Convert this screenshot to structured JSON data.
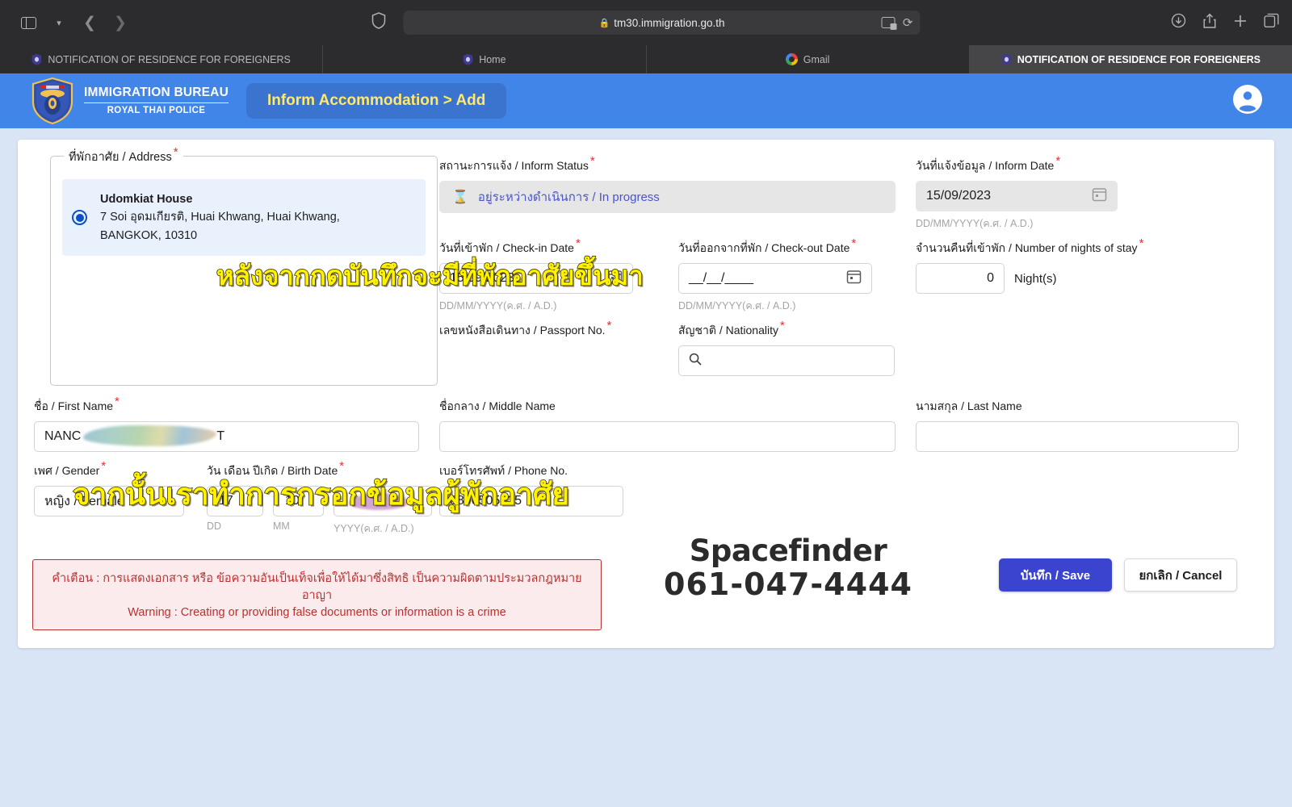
{
  "browser": {
    "url": "tm30.immigration.go.th",
    "lock_icon": "lock-icon",
    "sidebar_icon": "sidebar-toggle-icon",
    "back_icon": "back-chevron-icon",
    "forward_icon": "forward-chevron-icon",
    "shield_icon": "privacy-shield-icon",
    "translate_icon": "translate-icon",
    "reload_icon": "reload-icon",
    "download_icon": "download-icon",
    "share_icon": "share-icon",
    "new_tab_icon": "plus-icon",
    "tab_overview_icon": "tab-overview-icon",
    "tabs": [
      {
        "label": "NOTIFICATION OF RESIDENCE FOR FOREIGNERS",
        "favicon": "immigration-shield-favicon",
        "active": false
      },
      {
        "label": "Home",
        "favicon": "immigration-shield-favicon",
        "active": false
      },
      {
        "label": "Gmail",
        "favicon": "gmail-favicon",
        "active": false
      },
      {
        "label": "NOTIFICATION OF RESIDENCE FOR FOREIGNERS",
        "favicon": "immigration-shield-favicon",
        "active": true
      }
    ]
  },
  "header": {
    "logo_line1": "IMMIGRATION BUREAU",
    "logo_line2": "ROYAL THAI POLICE",
    "page_title": "Inform Accommodation > Add",
    "avatar_icon": "account-circle-icon",
    "bg_color": "#4285e8",
    "pill_color": "#3b74cf",
    "pill_text_color": "#ffe96b"
  },
  "annotations": [
    {
      "text": "หลังจากกดบันทึกจะมีที่พักอาศัยขึ้นมา",
      "color": "#fff200"
    },
    {
      "text": "จากนั้นเราทำการกรอกข้อมูลผู้พักอาศัย",
      "color": "#fff200"
    }
  ],
  "address_section": {
    "legend": "ที่พักอาศัย / Address",
    "required": "*",
    "option": {
      "name": "Udomkiat House",
      "line1": "7 Soi อุดมเกียรติ, Huai Khwang, Huai Khwang,",
      "line2": "BANGKOK, 10310",
      "selected": true,
      "radio_color": "#0b4fc9"
    }
  },
  "form": {
    "inform_status": {
      "label": "สถานะการแจ้ง / Inform Status",
      "value": "อยู่ระหว่างดำเนินการ / In progress",
      "icon": "hourglass-icon",
      "value_color": "#4a55c9"
    },
    "inform_date": {
      "label": "วันที่แจ้งข้อมูล / Inform Date",
      "value": "15/09/2023",
      "hint": "DD/MM/YYYY(ค.ศ. / A.D.)",
      "icon": "calendar-icon"
    },
    "checkin_date": {
      "label": "วันที่เข้าพัก / Check-in Date",
      "value": "15/09/2023",
      "hint": "DD/MM/YYYY(ค.ศ. / A.D.)",
      "icon": "calendar-icon"
    },
    "checkout_date": {
      "label": "วันที่ออกจากที่พัก / Check-out Date",
      "value": "__/__/____",
      "hint": "DD/MM/YYYY(ค.ศ. / A.D.)",
      "icon": "calendar-icon"
    },
    "nights": {
      "label": "จำนวนคืนที่เข้าพัก / Number of nights of stay",
      "value": "0",
      "unit": "Night(s)"
    },
    "passport_no": {
      "label": "เลขหนังสือเดินทาง / Passport No.",
      "value": ""
    },
    "nationality": {
      "label": "สัญชาติ / Nationality",
      "value": "",
      "icon": "search-icon"
    },
    "first_name": {
      "label": "ชื่อ / First Name",
      "value_prefix": "NANC",
      "value_suffix": "T",
      "redacted": true
    },
    "middle_name": {
      "label": "ชื่อกลาง / Middle Name",
      "value": ""
    },
    "last_name": {
      "label": "นามสกุล / Last Name",
      "value": ""
    },
    "gender": {
      "label": "เพศ / Gender",
      "value": "หญิง / Female",
      "caret_icon": "chevron-down-icon"
    },
    "birth_date": {
      "label": "วัน เดือน ปีเกิด / Birth Date",
      "day": "17",
      "month": "10",
      "year": "",
      "year_redacted": true,
      "hint_dd": "DD",
      "hint_mm": "MM",
      "hint_yyyy": "YYYY(ค.ศ. / A.D.)"
    },
    "phone_no": {
      "label": "เบอร์โทรศัพท์ / Phone No.",
      "value": "0890505525"
    }
  },
  "warning": {
    "thai": "คำเตือน : การแสดงเอกสาร หรือ ข้อความอันเป็นเท็จเพื่อให้ได้มาซึ่งสิทธิ เป็นความผิดตามประมวลกฎหมายอาญา",
    "english": "Warning : Creating or providing false documents or information is a crime",
    "border_color": "#b9312f",
    "bg_color": "#fbebec"
  },
  "watermark": {
    "brand": "Spacefinder",
    "phone": "061-047-4444"
  },
  "actions": {
    "save_label": "บันทึก / Save",
    "cancel_label": "ยกเลิก / Cancel",
    "save_color": "#3b44cf"
  }
}
